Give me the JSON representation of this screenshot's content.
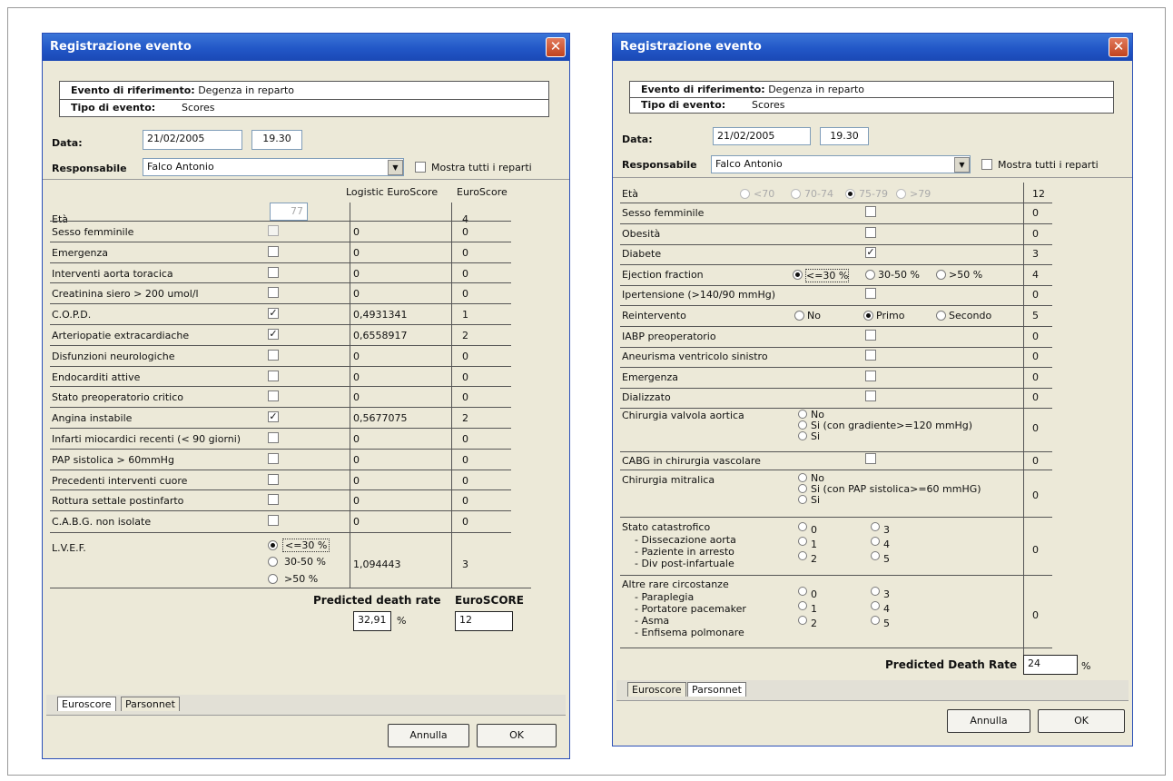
{
  "window_title": "Registrazione evento",
  "info": {
    "ref_label": "Evento di riferimento:",
    "ref_value": "Degenza in reparto",
    "type_label": "Tipo di evento:",
    "type_value": "Scores"
  },
  "data_label": "Data:",
  "date": "21/02/2005",
  "time": "19.30",
  "responsabile_label": "Responsabile",
  "responsabile": "Falco Antonio",
  "mostra_label": "Mostra tutti i reparti",
  "euroscore": {
    "col_logistic": "Logistic EuroScore",
    "col_euro": "EuroScore",
    "eta_label": "Età",
    "eta_value": "77",
    "eta_score": "4",
    "rows": [
      {
        "label": "Sesso femminile",
        "checked": false,
        "disabled": true,
        "log": "0",
        "score": "0"
      },
      {
        "label": "Emergenza",
        "checked": false,
        "log": "0",
        "score": "0"
      },
      {
        "label": "Interventi aorta toracica",
        "checked": false,
        "log": "0",
        "score": "0"
      },
      {
        "label": "Creatinina siero > 200 umol/l",
        "checked": false,
        "log": "0",
        "score": "0"
      },
      {
        "label": "C.O.P.D.",
        "checked": true,
        "log": "0,4931341",
        "score": "1"
      },
      {
        "label": "Arteriopatie extracardiache",
        "checked": true,
        "log": "0,6558917",
        "score": "2"
      },
      {
        "label": "Disfunzioni neurologiche",
        "checked": false,
        "log": "0",
        "score": "0"
      },
      {
        "label": "Endocarditi attive",
        "checked": false,
        "log": "0",
        "score": "0"
      },
      {
        "label": "Stato preoperatorio critico",
        "checked": false,
        "log": "0",
        "score": "0"
      },
      {
        "label": "Angina instabile",
        "checked": true,
        "log": "0,5677075",
        "score": "2"
      },
      {
        "label": "Infarti miocardici recenti (< 90 giorni)",
        "checked": false,
        "log": "0",
        "score": "0"
      },
      {
        "label": "PAP sistolica > 60mmHg",
        "checked": false,
        "log": "0",
        "score": "0"
      },
      {
        "label": "Precedenti interventi cuore",
        "checked": false,
        "log": "0",
        "score": "0"
      },
      {
        "label": "Rottura settale postinfarto",
        "checked": false,
        "log": "0",
        "score": "0"
      },
      {
        "label": "C.A.B.G. non isolate",
        "checked": false,
        "log": "0",
        "score": "0"
      }
    ],
    "lvef_label": "L.V.E.F.",
    "lvef_options": [
      "<=30 %",
      "30-50 %",
      ">50 %"
    ],
    "lvef_log": "1,094443",
    "lvef_score": "3",
    "pdr_label": "Predicted death rate",
    "pdr_value": "32,91",
    "pdr_unit": "%",
    "euroscore_total_label": "EuroSCORE",
    "euroscore_total": "12"
  },
  "parsonnet": {
    "eta_label": "Età",
    "eta_options": [
      "<70",
      "70-74",
      "75-79",
      ">79"
    ],
    "eta_score": "12",
    "rows": [
      {
        "label": "Sesso femminile",
        "type": "check",
        "checked": false,
        "score": "0"
      },
      {
        "label": "Obesità",
        "type": "check",
        "checked": false,
        "score": "0"
      },
      {
        "label": "Diabete",
        "type": "check",
        "checked": true,
        "score": "3"
      },
      {
        "label": "Ejection fraction",
        "type": "radio",
        "options": [
          "<=30 %",
          "30-50 %",
          ">50 %"
        ],
        "selected": 0,
        "score": "4"
      },
      {
        "label": "Ipertensione (>140/90 mmHg)",
        "type": "check",
        "checked": false,
        "score": "0"
      },
      {
        "label": "Reintervento",
        "type": "radio",
        "options": [
          "No",
          "Primo",
          "Secondo"
        ],
        "selected": 1,
        "score": "5"
      },
      {
        "label": "IABP preoperatorio",
        "type": "check",
        "checked": false,
        "score": "0"
      },
      {
        "label": "Aneurisma ventricolo sinistro",
        "type": "check",
        "checked": false,
        "score": "0"
      },
      {
        "label": "Emergenza",
        "type": "check",
        "checked": false,
        "score": "0"
      },
      {
        "label": "Dializzato",
        "type": "check",
        "checked": false,
        "score": "0"
      }
    ],
    "valv_label": "Chirurgia valvola aortica",
    "valv_options": [
      "No",
      "Si (con gradiente>=120 mmHg)",
      "Si"
    ],
    "valv_score": "0",
    "cabg_label": "CABG in chirurgia vascolare",
    "cabg_score": "0",
    "mitr_label": "Chirurgia mitralica",
    "mitr_options": [
      "No",
      "Si (con PAP sistolica>=60 mmHG)",
      "Si"
    ],
    "mitr_score": "0",
    "cat_label": "Stato catastrofico",
    "cat_items": [
      "- Dissecazione aorta",
      "- Paziente in arresto",
      "- Div post-infartuale"
    ],
    "cat_options": [
      "0",
      "1",
      "2",
      "3",
      "4",
      "5"
    ],
    "cat_score": "0",
    "rare_label": "Altre rare circostanze",
    "rare_items": [
      "- Paraplegia",
      "- Portatore pacemaker",
      "- Asma",
      "- Enfisema polmonare"
    ],
    "rare_options": [
      "0",
      "1",
      "2",
      "3",
      "4",
      "5"
    ],
    "rare_score": "0",
    "pdr_label": "Predicted Death Rate",
    "pdr_value": "24",
    "pdr_unit": "%"
  },
  "tabs": [
    "Euroscore",
    "Parsonnet"
  ],
  "buttons": {
    "cancel": "Annulla",
    "ok": "OK"
  }
}
